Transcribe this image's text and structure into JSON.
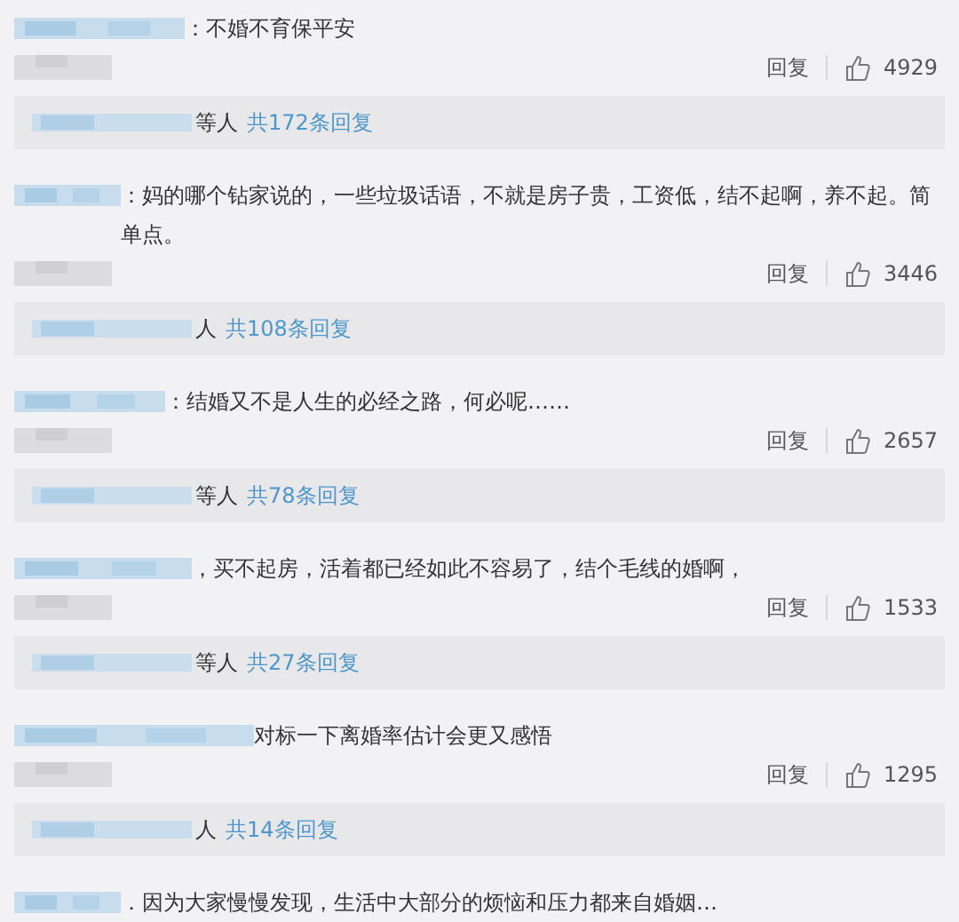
{
  "comments": [
    {
      "text": "：不婚不育保平安",
      "reply_label": "回复",
      "likes": "4929",
      "thread": {
        "others": "等人",
        "count_link": "共172条回复"
      }
    },
    {
      "text": "：妈的哪个钻家说的，一些垃圾话语，不就是房子贵，工资低，结不起啊，养不起。简单点。",
      "reply_label": "回复",
      "likes": "3446",
      "thread": {
        "others": "人",
        "count_link": "共108条回复"
      }
    },
    {
      "text": "：结婚又不是人生的必经之路，何必呢……",
      "reply_label": "回复",
      "likes": "2657",
      "thread": {
        "others": "等人",
        "count_link": "共78条回复"
      }
    },
    {
      "text": "，买不起房，活着都已经如此不容易了，结个毛线的婚啊，",
      "reply_label": "回复",
      "likes": "1533",
      "thread": {
        "others": "等人",
        "count_link": "共27条回复"
      }
    },
    {
      "text": "对标一下离婚率估计会更又感悟",
      "reply_label": "回复",
      "likes": "1295",
      "thread": {
        "others": "人",
        "count_link": "共14条回复"
      }
    },
    {
      "text": "．因为大家慢慢发现，生活中大部分的烦恼和压力都来自婚姻…"
    }
  ]
}
